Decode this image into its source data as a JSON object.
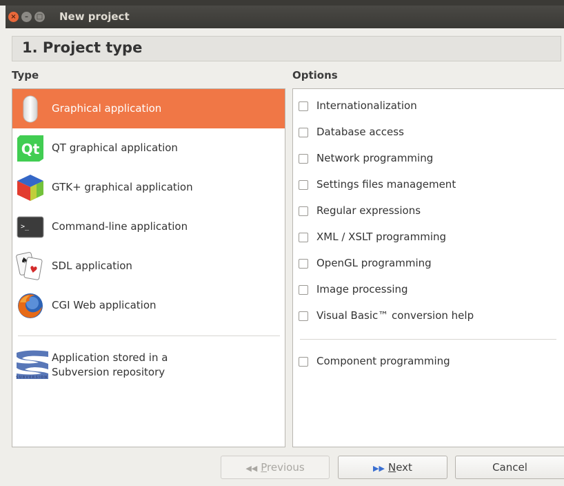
{
  "window": {
    "title": "New project",
    "controls": {
      "close": "×",
      "minimize": "–",
      "maximize": "□"
    }
  },
  "header": {
    "step_title": "1. Project type"
  },
  "type_column": {
    "label": "Type",
    "items": [
      {
        "label": "Graphical application",
        "icon": "mouse-icon",
        "selected": true
      },
      {
        "label": "QT graphical application",
        "icon": "qt-logo-icon",
        "selected": false
      },
      {
        "label": "GTK+ graphical application",
        "icon": "gtk-cube-icon",
        "selected": false
      },
      {
        "label": "Command-line application",
        "icon": "terminal-icon",
        "selected": false
      },
      {
        "label": "SDL application",
        "icon": "playing-cards-icon",
        "selected": false
      },
      {
        "label": "CGI Web application",
        "icon": "firefox-icon",
        "selected": false
      }
    ],
    "svn_item": {
      "line1": "Application stored in a",
      "line2": "Subversion repository",
      "icon": "subversion-logo-icon",
      "logo_text": "SUBVERSION"
    }
  },
  "options_column": {
    "label": "Options",
    "items": [
      {
        "label": "Internationalization",
        "checked": false
      },
      {
        "label": "Database access",
        "checked": false
      },
      {
        "label": "Network programming",
        "checked": false
      },
      {
        "label": "Settings files management",
        "checked": false
      },
      {
        "label": "Regular expressions",
        "checked": false
      },
      {
        "label": "XML / XSLT programming",
        "checked": false
      },
      {
        "label": "OpenGL programming",
        "checked": false
      },
      {
        "label": "Image processing",
        "checked": false
      },
      {
        "label": "Visual Basic™ conversion help",
        "checked": false
      }
    ],
    "extra_item": {
      "label": "Component programming",
      "checked": false
    }
  },
  "buttons": {
    "previous": {
      "arrow": "◀◀",
      "mnemonic": "P",
      "rest": "revious",
      "enabled": false
    },
    "next": {
      "arrow": "▶▶",
      "mnemonic": "N",
      "rest": "ext",
      "enabled": true
    },
    "cancel": {
      "label": "Cancel",
      "enabled": true
    }
  },
  "colors": {
    "selection": "#f07746",
    "titlebar": "#3c3b37",
    "close_button": "#e9683a"
  }
}
